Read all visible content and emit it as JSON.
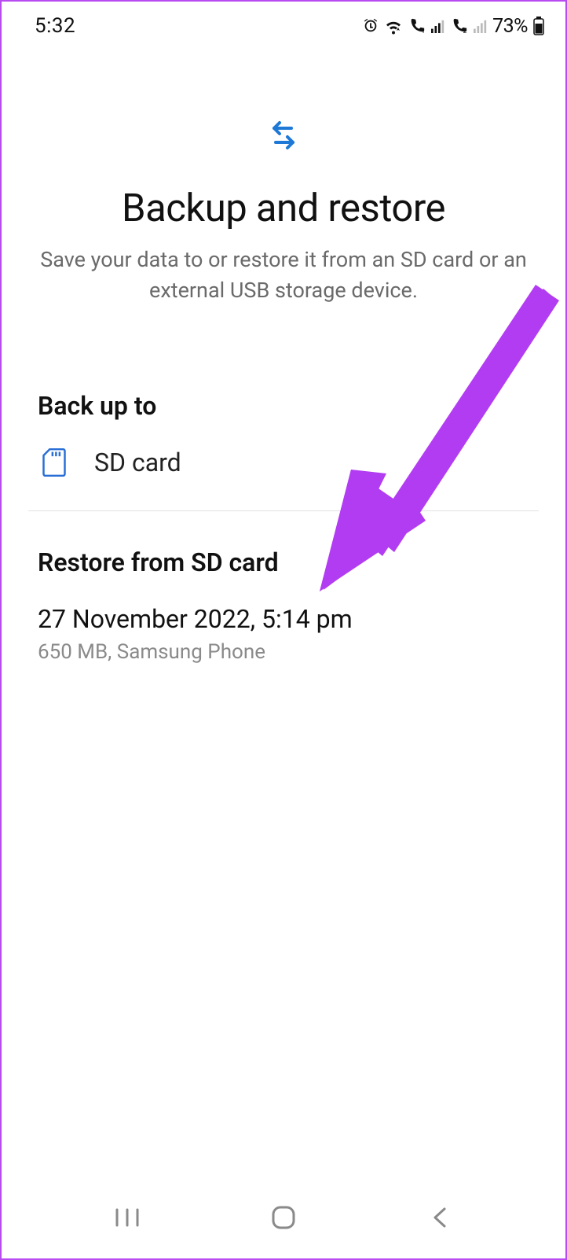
{
  "status": {
    "time": "5:32",
    "battery_pct": "73%"
  },
  "header": {
    "title": "Backup and restore",
    "subtitle": "Save your data to or restore it from an SD card or an external USB storage device."
  },
  "backup": {
    "section_title": "Back up to",
    "target_label": "SD card"
  },
  "restore": {
    "section_title": "Restore from SD card",
    "item": {
      "title": "27 November 2022, 5:14 pm",
      "subtitle": "650 MB, Samsung Phone"
    }
  }
}
